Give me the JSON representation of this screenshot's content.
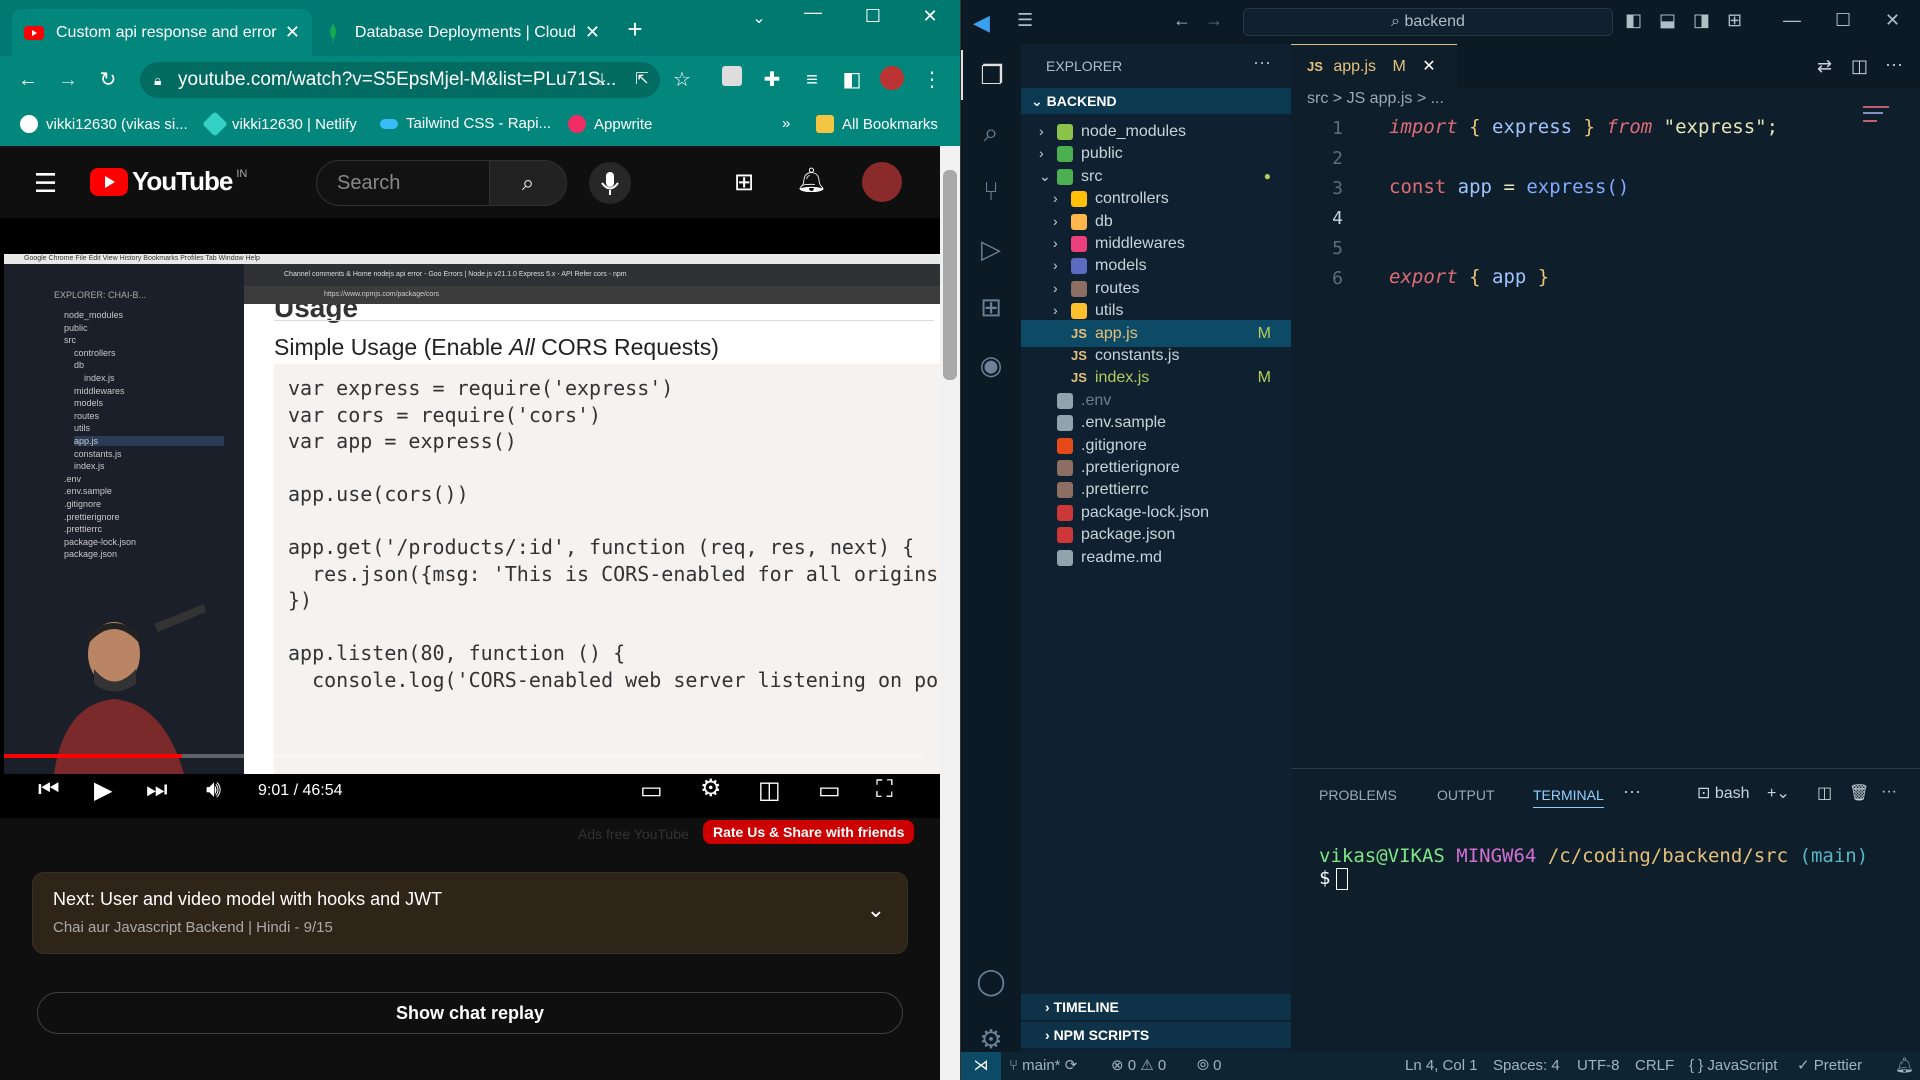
{
  "chrome": {
    "tabs": [
      {
        "title": "Custom api response and error h",
        "icon": "youtube-icon",
        "active": true
      },
      {
        "title": "Database Deployments | Cloud:",
        "icon": "mongodb-leaf-icon",
        "active": false
      }
    ],
    "url": "youtube.com/watch?v=S5EpsMjel-M&list=PLu71S...",
    "bookmarks": [
      {
        "label": "vikki12630 (vikas si...",
        "icon": "github-icon"
      },
      {
        "label": "vikki12630 | Netlify",
        "icon": "netlify-icon"
      },
      {
        "label": "Tailwind CSS - Rapi...",
        "icon": "tailwind-icon"
      },
      {
        "label": "Appwrite",
        "icon": "appwrite-icon"
      }
    ],
    "bookmarks_more": "»",
    "all_bookmarks": "All Bookmarks"
  },
  "youtube": {
    "logo_text": "YouTube",
    "region": "IN",
    "search_placeholder": "Search",
    "video": {
      "mac_menu": "Google Chrome   File   Edit   View   History   Bookmarks   Profiles   Tab   Window   Help",
      "browser_tabs": "Channel comments &   Home   nodejs api error - Goo   Errors | Node.js v21.1.0   Express 5.x - API Refer   cors - npm",
      "browser_url": "https://www.npmjs.com/package/cors",
      "explorer_title": "EXPLORER: CHAI-B...",
      "explorer_items": [
        "node_modules",
        "public",
        "src",
        "controllers",
        "db",
        "index.js",
        "middlewares",
        "models",
        "routes",
        "utils",
        "app.js",
        "constants.js",
        "index.js",
        ".env",
        ".env.sample",
        ".gitignore",
        ".prettierignore",
        ".prettierrc",
        "package-lock.json",
        "package.json"
      ],
      "heading_cut": "Usage",
      "subheading_pre": "Simple Usage (Enable ",
      "subheading_em": "All",
      "subheading_post": " CORS Requests)",
      "code_lines": [
        "var express = require('express')",
        "var cors = require('cors')",
        "var app = express()",
        "",
        "app.use(cors())",
        "",
        "app.get('/products/:id', function (req, res, next) {",
        "  res.json({msg: 'This is CORS-enabled for all origins",
        "})",
        "",
        "app.listen(80, function () {",
        "  console.log('CORS-enabled web server listening on po"
      ]
    },
    "time": "9:01 / 46:54",
    "progress": 0.193,
    "ads_free": "Ads free YouTube",
    "rate_button": "Rate Us & Share with friends",
    "next": {
      "title": "Next: User and video model with hooks and JWT",
      "subtitle": "Chai aur Javascript Backend | Hindi - 9/15"
    },
    "chat_replay": "Show chat replay"
  },
  "vscode": {
    "search": "backend",
    "explorer_label": "EXPLORER",
    "root": "BACKEND",
    "tree": [
      {
        "label": "node_modules",
        "depth": 1,
        "chev": ">",
        "icon": "folder-node-icon",
        "color": "#8bc34a"
      },
      {
        "label": "public",
        "depth": 1,
        "chev": ">",
        "icon": "folder-public-icon",
        "color": "#4caf50"
      },
      {
        "label": "src",
        "depth": 1,
        "chev": "v",
        "icon": "folder-src-icon",
        "color": "#4caf50"
      },
      {
        "label": "controllers",
        "depth": 2,
        "chev": ">",
        "icon": "folder-controllers-icon",
        "color": "#ffc107"
      },
      {
        "label": "db",
        "depth": 2,
        "chev": ">",
        "icon": "folder-db-icon",
        "color": "#ffb74d"
      },
      {
        "label": "middlewares",
        "depth": 2,
        "chev": ">",
        "icon": "folder-middleware-icon",
        "color": "#ec407a"
      },
      {
        "label": "models",
        "depth": 2,
        "chev": ">",
        "icon": "folder-models-icon",
        "color": "#5c6bc0"
      },
      {
        "label": "routes",
        "depth": 2,
        "chev": ">",
        "icon": "folder-routes-icon",
        "color": "#8d6e63"
      },
      {
        "label": "utils",
        "depth": 2,
        "chev": ">",
        "icon": "folder-utils-icon",
        "color": "#fbc02d"
      },
      {
        "label": "app.js",
        "depth": 2,
        "chev": "",
        "icon": "js-file-icon",
        "color": "#e5c07b",
        "mod": "M",
        "selected": true
      },
      {
        "label": "constants.js",
        "depth": 2,
        "chev": "",
        "icon": "js-file-icon",
        "color": "#e5c07b"
      },
      {
        "label": "index.js",
        "depth": 2,
        "chev": "",
        "icon": "js-file-icon",
        "color": "#e5c07b",
        "mod": "M"
      },
      {
        "label": ".env",
        "depth": 1,
        "chev": "",
        "icon": "gear-file-icon",
        "color": "#90a4ae",
        "dim": true
      },
      {
        "label": ".env.sample",
        "depth": 1,
        "chev": "",
        "icon": "terminal-file-icon",
        "color": "#90a4ae"
      },
      {
        "label": ".gitignore",
        "depth": 1,
        "chev": "",
        "icon": "git-file-icon",
        "color": "#e64a19"
      },
      {
        "label": ".prettierignore",
        "depth": 1,
        "chev": "",
        "icon": "prettier-file-icon",
        "color": "#8d6e63"
      },
      {
        "label": ".prettierrc",
        "depth": 1,
        "chev": "",
        "icon": "prettier-file-icon",
        "color": "#8d6e63"
      },
      {
        "label": "package-lock.json",
        "depth": 1,
        "chev": "",
        "icon": "npm-file-icon",
        "color": "#cb3837"
      },
      {
        "label": "package.json",
        "depth": 1,
        "chev": "",
        "icon": "npm-file-icon",
        "color": "#cb3837"
      },
      {
        "label": "readme.md",
        "depth": 1,
        "chev": "",
        "icon": "markdown-file-icon",
        "color": "#90a4ae"
      }
    ],
    "timeline": "TIMELINE",
    "npm_scripts": "NPM SCRIPTS",
    "tab": {
      "label": "app.js",
      "badge": "M"
    },
    "breadcrumb": "src  >  JS  app.js  >  ...",
    "code": [
      {
        "n": "1"
      },
      {
        "n": "2"
      },
      {
        "n": "3"
      },
      {
        "n": "4"
      },
      {
        "n": "5"
      },
      {
        "n": "6"
      }
    ],
    "code_tokens": {
      "import": "import",
      "open": "{",
      "express": "express",
      "close": "}",
      "from": "from",
      "module": "\"express\";",
      "const": "const",
      "app": "app",
      "eq": "=",
      "call": "express()",
      "export": "export",
      "app2": "app"
    },
    "panel_tabs": [
      "PROBLEMS",
      "OUTPUT",
      "TERMINAL"
    ],
    "panel_dots": "···",
    "shell": "bash",
    "terminal": {
      "user": "vikas@VIKAS",
      "host": "MINGW64",
      "path": "/c/coding/backend/src",
      "branch": "(main)",
      "prompt": "$"
    },
    "status": {
      "branch": "main*",
      "errors": "0",
      "warnings": "0",
      "ports": "0",
      "position": "Ln 4, Col 1",
      "spaces": "Spaces: 4",
      "encoding": "UTF-8",
      "eol": "CRLF",
      "language": "JavaScript",
      "prettier": "Prettier"
    }
  }
}
